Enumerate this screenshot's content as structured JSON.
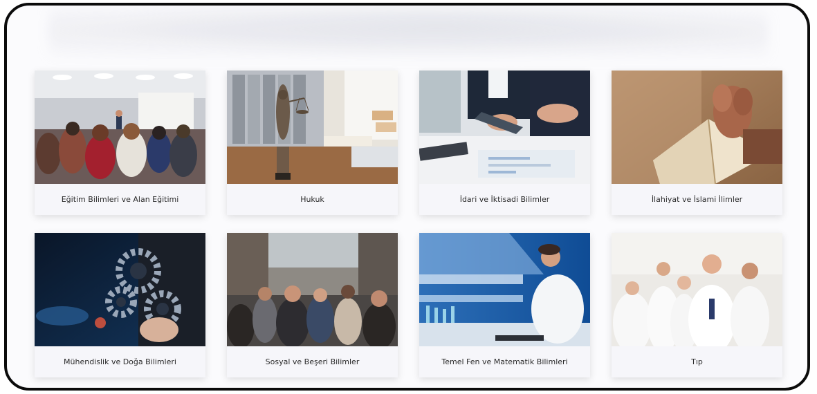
{
  "categories": [
    {
      "label": "Eğitim Bilimleri ve Alan Eğitimi",
      "icon": "lecture-hall-image"
    },
    {
      "label": "Hukuk",
      "icon": "justice-statue-image"
    },
    {
      "label": "İdari ve İktisadi Bilimler",
      "icon": "business-meeting-image"
    },
    {
      "label": "İlahiyat ve İslami İlimler",
      "icon": "praying-hands-image"
    },
    {
      "label": "Mühendislik ve Doğa Bilimleri",
      "icon": "gears-engineering-image"
    },
    {
      "label": "Sosyal ve Beşeri Bilimler",
      "icon": "crowd-street-image"
    },
    {
      "label": "Temel Fen ve Matematik Bilimleri",
      "icon": "laboratory-scientist-image"
    },
    {
      "label": "Tıp",
      "icon": "doctors-team-image"
    }
  ]
}
